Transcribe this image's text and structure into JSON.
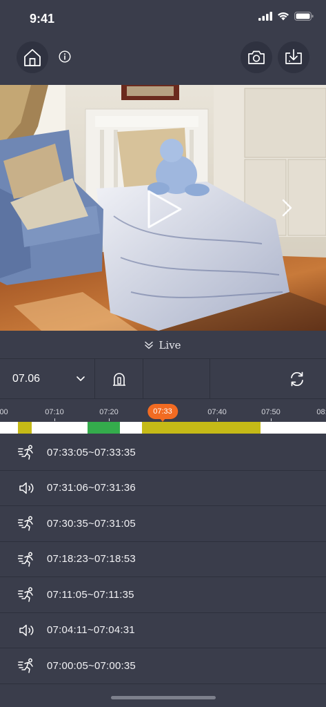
{
  "status": {
    "time": "9:41"
  },
  "live": {
    "label": "Live"
  },
  "controls": {
    "date": "07.06"
  },
  "timeline": {
    "ticks": [
      ":00",
      "07:10",
      "07:20",
      "07:40",
      "07:50",
      "08:"
    ],
    "now": "07:33",
    "colors": {
      "track": "#ffffff",
      "motion": "#c5ba17",
      "sound": "#34ac4c",
      "now": "#f26b22"
    }
  },
  "events": [
    {
      "type": "motion-icon",
      "time": "07:33:05~07:33:35"
    },
    {
      "type": "sound-icon",
      "time": "07:31:06~07:31:36"
    },
    {
      "type": "motion-icon",
      "time": "07:30:35~07:31:05"
    },
    {
      "type": "motion-icon",
      "time": "07:18:23~07:18:53"
    },
    {
      "type": "motion-icon",
      "time": "07:11:05~07:11:35"
    },
    {
      "type": "sound-icon",
      "time": "07:04:11~07:04:31"
    },
    {
      "type": "motion-icon",
      "time": "07:00:05~07:00:35"
    }
  ]
}
